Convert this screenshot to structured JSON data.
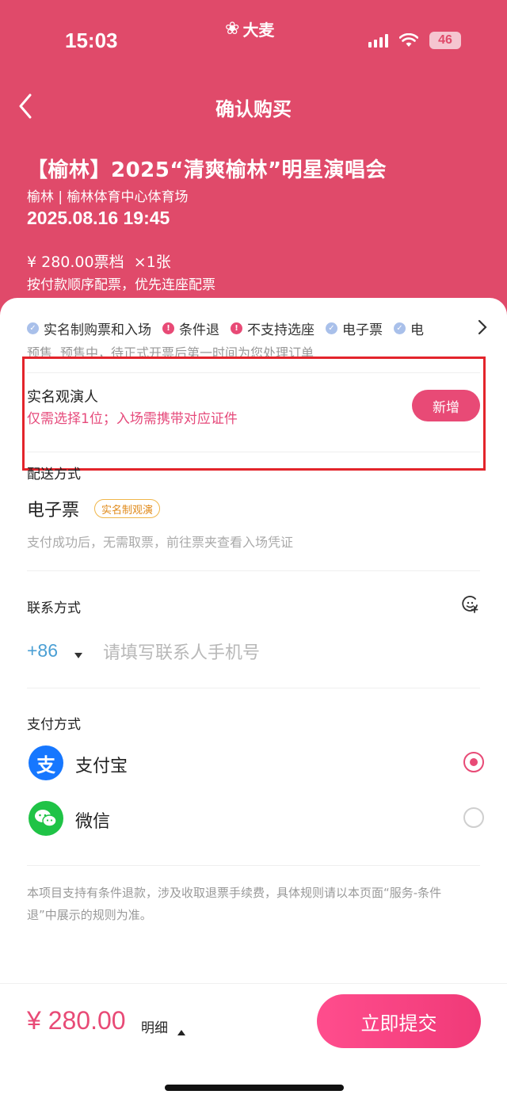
{
  "status_bar": {
    "time": "15:03",
    "brand": "大麦",
    "battery": "46"
  },
  "nav": {
    "title": "确认购买"
  },
  "event": {
    "title": "【榆林】2025“清爽榆林”明星演唱会",
    "venue": "榆林 | 榆林体育中心体育场",
    "datetime": "2025.08.16 19:45",
    "price_tier": "¥ 280.00票档  ×1张",
    "seat_note": "按付款顺序配票，优先连座配票"
  },
  "tags": [
    {
      "label": "实名制购票和入场",
      "icon": "check-icon",
      "color": "#a9c0ea"
    },
    {
      "label": "条件退",
      "icon": "exclamation-icon",
      "color": "#e84a76"
    },
    {
      "label": "不支持选座",
      "icon": "exclamation-icon",
      "color": "#e84a76"
    },
    {
      "label": "电子票",
      "icon": "check-icon",
      "color": "#a9c0ea"
    },
    {
      "label": "电",
      "icon": "check-icon",
      "color": "#a9c0ea"
    }
  ],
  "presale": {
    "label": "预售",
    "text": "预售中，待正式开票后第一时间为您处理订单"
  },
  "viewer": {
    "title": "实名观演人",
    "hint": "仅需选择1位；入场需携带对应证件",
    "add_label": "新增"
  },
  "delivery": {
    "label": "配送方式",
    "type": "电子票",
    "badge": "实名制观演",
    "note": "支付成功后，无需取票，前往票夹查看入场凭证"
  },
  "contact": {
    "label": "联系方式",
    "country_code": "+86",
    "phone_value": "",
    "phone_placeholder": "请填写联系人手机号"
  },
  "payment": {
    "label": "支付方式",
    "methods": [
      {
        "name": "支付宝",
        "logo": "支",
        "color": "#1677ff",
        "selected": true
      },
      {
        "name": "微信",
        "logo": "wechat-icon",
        "color": "#1fc346",
        "selected": false
      }
    ]
  },
  "refund_note": "本项目支持有条件退款，涉及收取退票手续费，具体规则请以本页面“服务-条件退”中展示的规则为准。",
  "footer": {
    "total": "¥ 280.00",
    "detail_label": "明细",
    "submit_label": "立即提交"
  },
  "colors": {
    "header_bg": "#e04a6a",
    "accent": "#e84a76"
  }
}
